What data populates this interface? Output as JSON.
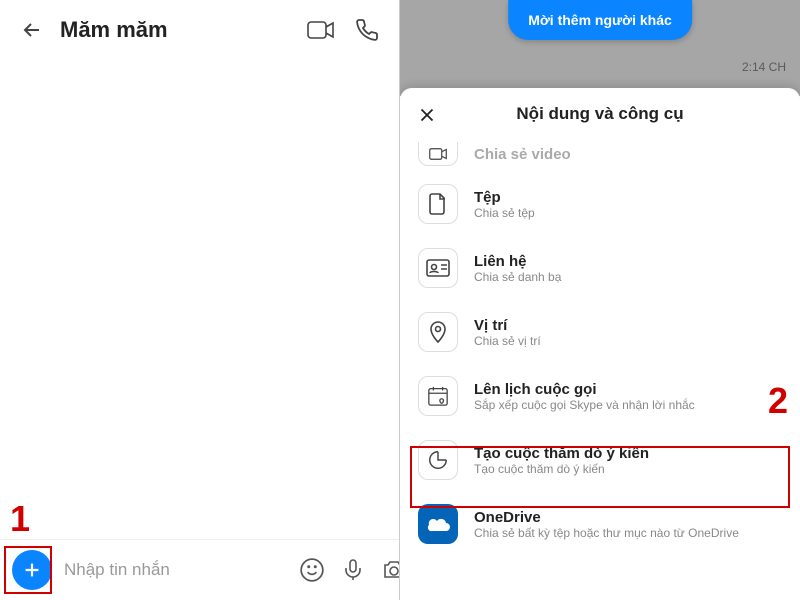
{
  "left": {
    "chat_title": "Măm măm",
    "input_placeholder": "Nhập tin nhắn"
  },
  "right": {
    "invite_label": "Mời thêm người khác",
    "timestamp": "2:14 CH",
    "sheet_title": "Nội dung và công cụ",
    "items": [
      {
        "title": "Chia sẻ video",
        "subtitle": ""
      },
      {
        "title": "Tệp",
        "subtitle": "Chia sẻ tệp"
      },
      {
        "title": "Liên hệ",
        "subtitle": "Chia sẻ danh bạ"
      },
      {
        "title": "Vị trí",
        "subtitle": "Chia sẻ vị trí"
      },
      {
        "title": "Lên lịch cuộc gọi",
        "subtitle": "Sắp xếp cuộc gọi Skype và nhận lời nhắc"
      },
      {
        "title": "Tạo cuộc thăm dò ý kiến",
        "subtitle": "Tạo cuộc thăm dò ý kiến"
      },
      {
        "title": "OneDrive",
        "subtitle": "Chia sẻ bất kỳ tệp hoặc thư mục nào từ OneDrive"
      }
    ]
  },
  "annotations": {
    "step1": "1",
    "step2": "2"
  }
}
